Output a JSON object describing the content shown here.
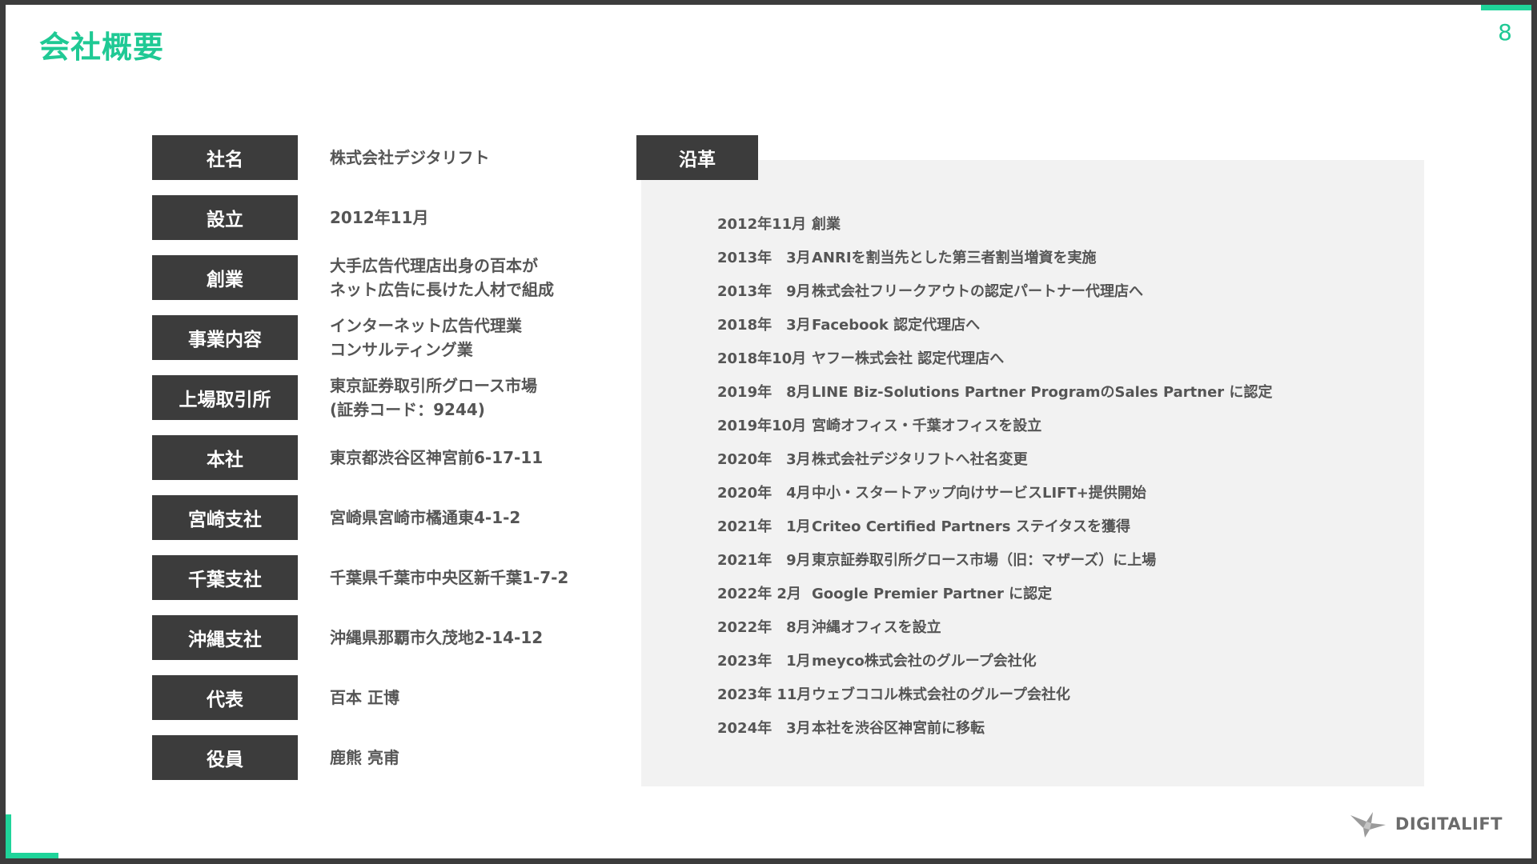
{
  "header": {
    "title": "会社概要",
    "page_number": "8"
  },
  "company_info": [
    {
      "label": "社名",
      "value": "株式会社デジタリフト"
    },
    {
      "label": "設立",
      "value": "2012年11月"
    },
    {
      "label": "創業",
      "value": "大手広告代理店出身の百本が\nネット広告に長けた人材で組成"
    },
    {
      "label": "事業内容",
      "value": "インターネット広告代理業\nコンサルティング業"
    },
    {
      "label": "上場取引所",
      "value": "東京証券取引所グロース市場\n(証券コード：9244)"
    },
    {
      "label": "本社",
      "value": "東京都渋谷区神宮前6-17-11"
    },
    {
      "label": "宮崎支社",
      "value": "宮崎県宮崎市橘通東4-1-2"
    },
    {
      "label": "千葉支社",
      "value": "千葉県千葉市中央区新千葉1-7-2"
    },
    {
      "label": "沖縄支社",
      "value": "沖縄県那覇市久茂地2-14-12"
    },
    {
      "label": "代表",
      "value": "百本 正博"
    },
    {
      "label": "役員",
      "value": "鹿熊 亮甫"
    }
  ],
  "history": {
    "label": "沿革",
    "items": [
      {
        "date": "2012年11月",
        "event": "創業"
      },
      {
        "date": "2013年　3月",
        "event": "ANRIを割当先とした第三者割当増資を実施"
      },
      {
        "date": "2013年　9月",
        "event": "株式会社フリークアウトの認定パートナー代理店へ"
      },
      {
        "date": "2018年　3月",
        "event": "Facebook 認定代理店へ"
      },
      {
        "date": "2018年10月",
        "event": "ヤフー株式会社 認定代理店へ"
      },
      {
        "date": "2019年　8月",
        "event": "LINE Biz-Solutions Partner ProgramのSales Partner に認定"
      },
      {
        "date": "2019年10月",
        "event": "宮崎オフィス・千葉オフィスを設立"
      },
      {
        "date": "2020年　3月",
        "event": "株式会社デジタリフトへ社名変更"
      },
      {
        "date": "2020年　4月",
        "event": "中小・スタートアップ向けサービスLIFT+提供開始"
      },
      {
        "date": "2021年　1月",
        "event": "Criteo Certified Partners ステイタスを獲得"
      },
      {
        "date": "2021年　9月",
        "event": " 東京証券取引所グロース市場（旧：マザーズ）に上場"
      },
      {
        "date": "2022年 2月",
        "event": "Google Premier Partner に認定"
      },
      {
        "date": "2022年　8月",
        "event": "沖縄オフィスを設立"
      },
      {
        "date": "2023年　1月",
        "event": "meyco株式会社のグループ会社化"
      },
      {
        "date": "2023年 11月",
        "event": "ウェブココル株式会社のグループ会社化"
      },
      {
        "date": "2024年　3月",
        "event": " 本社を渋谷区神宮前に移転"
      }
    ]
  },
  "logo": {
    "text": "DIGITALIFT",
    "icon": "bird-logo-icon"
  },
  "colors": {
    "accent": "#1fc994",
    "label_bg": "#3c3c3c",
    "panel_bg": "#f2f2f2"
  }
}
